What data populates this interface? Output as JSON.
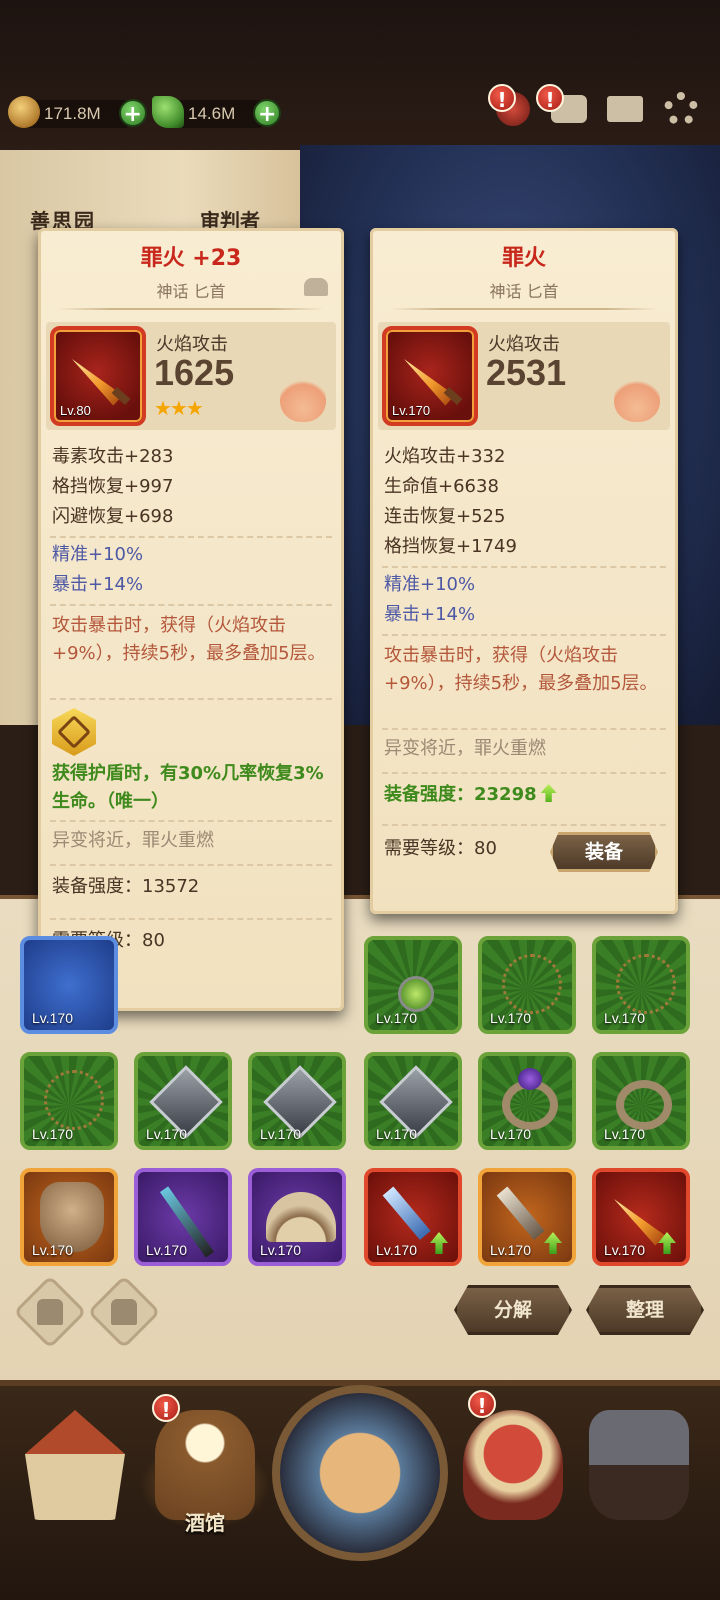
{
  "currency": {
    "gold": "171.8M",
    "leaf": "14.6M"
  },
  "background": {
    "book_title_left": "善思园",
    "book_title_right": "审判者"
  },
  "card_left": {
    "title": "罪火 +23",
    "subtitle": "神话 匕首",
    "level": "Lv.80",
    "main_stat_name": "火焰攻击",
    "main_stat_value": "1625",
    "stars": "★★★",
    "sub_stats": [
      "毒素攻击+283",
      "格挡恢复+997",
      "闪避恢复+698"
    ],
    "bonus_stats": [
      "精准+10%",
      "暴击+14%"
    ],
    "effect": "攻击暴击时，获得（火焰攻击+9%），持续5秒，最多叠加5层。",
    "rune_effect": "获得护盾时，有30%几率恢复3%生命。（唯一）",
    "set_hint": "异变将近，罪火重燃",
    "power": "装备强度：13572",
    "required_level": "需要等级：80"
  },
  "card_right": {
    "title": "罪火",
    "subtitle": "神话 匕首",
    "level": "Lv.170",
    "main_stat_name": "火焰攻击",
    "main_stat_value": "2531",
    "sub_stats": [
      "火焰攻击+332",
      "生命值+6638",
      "连击恢复+525",
      "格挡恢复+1749"
    ],
    "bonus_stats": [
      "精准+10%",
      "暴击+14%"
    ],
    "effect": "攻击暴击时，获得（火焰攻击+9%），持续5秒，最多叠加5层。",
    "set_hint": "异变将近，罪火重燃",
    "power": "装备强度：23298",
    "required_level": "需要等级：",
    "required_level_value": "80",
    "equip_label": "装备"
  },
  "inventory": {
    "slot_level": "Lv.170"
  },
  "actions": {
    "decompose": "分解",
    "arrange": "整理"
  },
  "nav": {
    "tavern": "酒馆"
  }
}
